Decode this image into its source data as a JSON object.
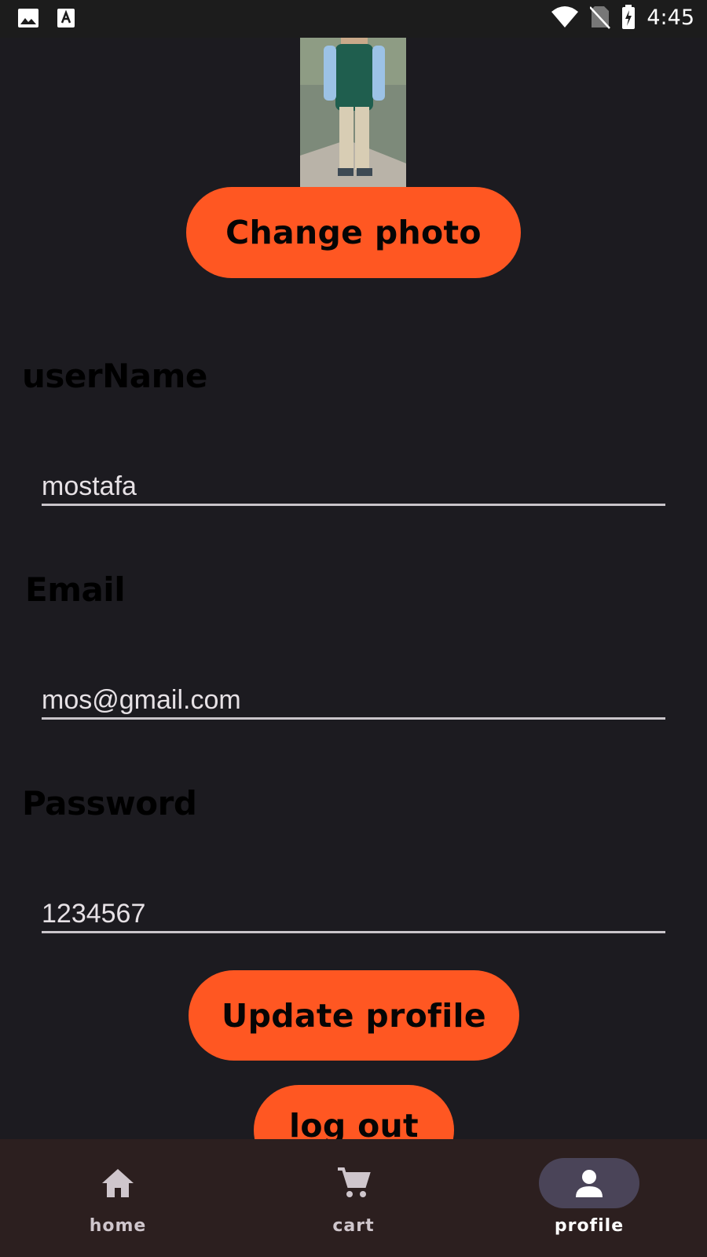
{
  "status_bar": {
    "time": "4:45",
    "icons": [
      "image-icon",
      "text-a-icon",
      "wifi-icon",
      "no-sim-icon",
      "battery-charging-icon"
    ]
  },
  "profile": {
    "photo_icon": "profile-photo",
    "change_photo_label": "Change photo",
    "username_label": "userName",
    "username_value": "mostafa",
    "email_label": "Email",
    "email_value": "mos@gmail.com",
    "password_label": "Password",
    "password_value": "1234567",
    "update_label": "Update profile",
    "logout_label": "log out"
  },
  "bottom_nav": {
    "items": [
      {
        "label": "home",
        "icon": "home-icon"
      },
      {
        "label": "cart",
        "icon": "cart-icon"
      },
      {
        "label": "profile",
        "icon": "person-icon",
        "selected": true
      }
    ]
  },
  "colors": {
    "background": "#1c1b20",
    "accent": "#ff5722",
    "nav_background": "#2c1f1f",
    "selected_indicator": "#4a4458"
  }
}
